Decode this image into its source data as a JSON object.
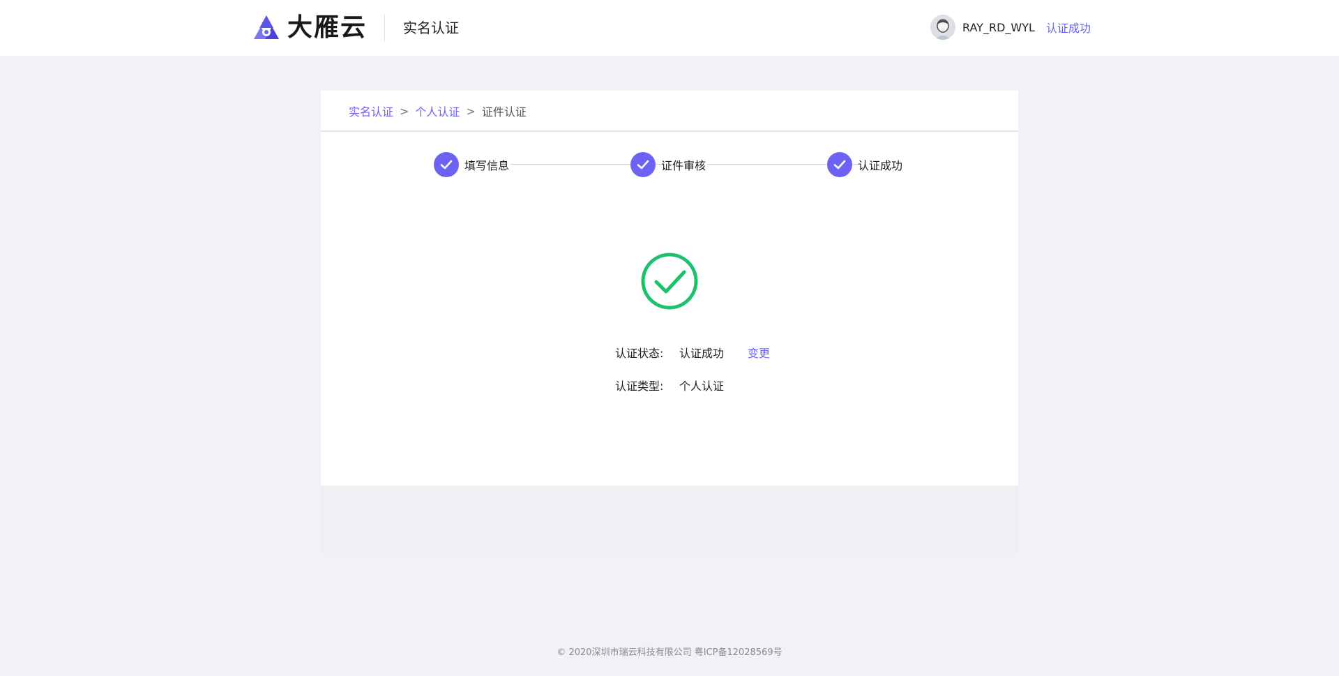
{
  "header": {
    "logo_text": "大雁云",
    "title": "实名认证",
    "username": "RAY_RD_WYL",
    "status_link": "认证成功"
  },
  "breadcrumb": {
    "items": [
      "实名认证",
      "个人认证"
    ],
    "current": "证件认证",
    "separator": ">"
  },
  "steps": [
    {
      "label": "填写信息",
      "done": true
    },
    {
      "label": "证件审核",
      "done": true
    },
    {
      "label": "认证成功",
      "done": true
    }
  ],
  "result": {
    "icon": "success-check-circle-icon",
    "status_label": "认证状态:",
    "status_value": "认证成功",
    "change_link": "变更",
    "type_label": "认证类型:",
    "type_value": "个人认证"
  },
  "footer": {
    "copyright": "© 2020深圳市瑞云科技有限公司 粤ICP备12028569号"
  },
  "colors": {
    "accent": "#6c63f5",
    "success": "#1bc26b",
    "background": "#f0f2f5"
  }
}
